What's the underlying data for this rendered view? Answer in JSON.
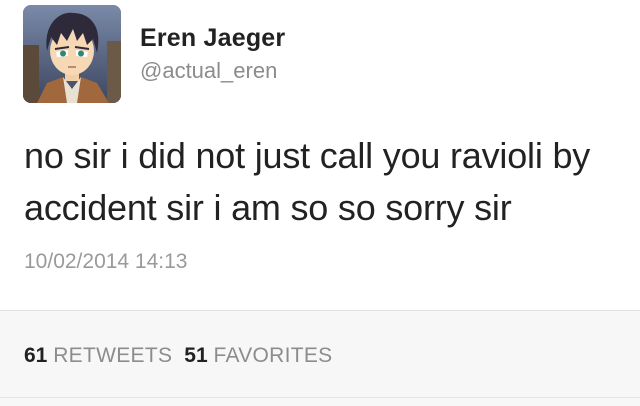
{
  "user": {
    "display_name": "Eren Jaeger",
    "handle": "@actual_eren"
  },
  "tweet": {
    "text": "no sir i did not just call you ravioli by accident sir i am so so sorry sir",
    "timestamp": "10/02/2014 14:13"
  },
  "stats": {
    "retweets_count": "61",
    "retweets_label": "RETWEETS",
    "favorites_count": "51",
    "favorites_label": "FAVORITES"
  },
  "colors": {
    "name": "#222222",
    "secondary": "#8c8c8c",
    "stats_background": "#f7f7f7"
  }
}
